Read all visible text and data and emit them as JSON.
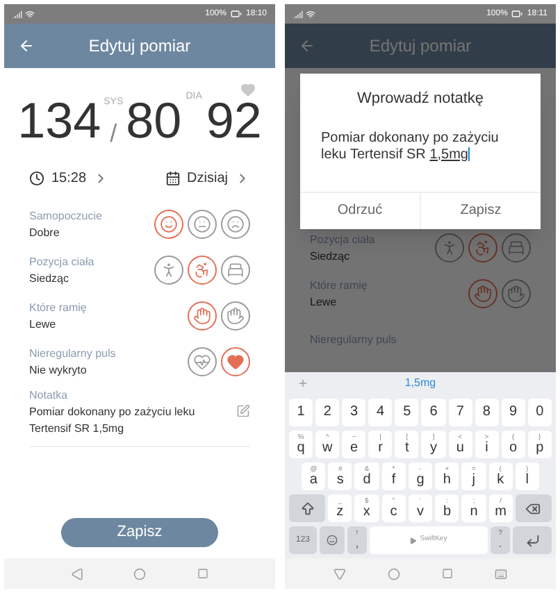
{
  "edit_screen": {
    "status_bar": {
      "battery": "100%",
      "time": "18:10"
    },
    "header": {
      "title": "Edytuj pomiar"
    },
    "reading": {
      "sys_label": "SYS",
      "sys": "134",
      "separator": "/",
      "dia_label": "DIA",
      "dia": "80",
      "pulse": "92"
    },
    "time": "15:28",
    "date": "Dzisiaj",
    "rows": [
      {
        "label": "Samopoczucie",
        "value": "Dobre",
        "options": [
          {
            "kind": "smile",
            "selected": true
          },
          {
            "kind": "neutral",
            "selected": false
          },
          {
            "kind": "sad",
            "selected": false
          }
        ]
      },
      {
        "label": "Pozycja ciała",
        "value": "Siedząc",
        "options": [
          {
            "kind": "standing",
            "selected": false
          },
          {
            "kind": "sitting",
            "selected": true
          },
          {
            "kind": "lying",
            "selected": false
          }
        ]
      },
      {
        "label": "Które ramię",
        "value": "Lewe",
        "options": [
          {
            "kind": "left_hand",
            "selected": true
          },
          {
            "kind": "right_hand",
            "selected": false
          }
        ]
      },
      {
        "label": "Nieregularny puls",
        "value": "Nie wykryto",
        "options": [
          {
            "kind": "pulse",
            "selected": false
          },
          {
            "kind": "heart",
            "selected": true
          }
        ]
      }
    ],
    "note": {
      "label": "Notatka",
      "text": "Pomiar dokonany po zażyciu leku Tertensif SR 1,5mg"
    },
    "save_button": "Zapisz"
  },
  "note_screen": {
    "status_bar": {
      "battery": "100%",
      "time": "18:11"
    },
    "header": {
      "title": "Edytuj pomiar"
    },
    "rows": [
      {
        "label": "Pozycja ciała",
        "value": "Siedząc",
        "options": [
          {
            "kind": "standing",
            "selected": false
          },
          {
            "kind": "sitting",
            "selected": true
          },
          {
            "kind": "lying",
            "selected": false
          }
        ]
      },
      {
        "label": "Które ramię",
        "value": "Lewe",
        "options": [
          {
            "kind": "left_hand",
            "selected": true
          },
          {
            "kind": "right_hand",
            "selected": false
          }
        ]
      },
      {
        "label": "Nieregularny puls"
      }
    ],
    "dialog": {
      "title": "Wprowadź notatkę",
      "text": "Pomiar dokonany po zażyciu leku Tertensif SR ",
      "composing": "1,5mg",
      "buttons": [
        "Odrzuć",
        "Zapisz"
      ]
    },
    "keyboard": {
      "suggestion": "1,5mg",
      "rows": [
        [
          {
            "kind": "char",
            "main": "1"
          },
          {
            "kind": "char",
            "main": "2"
          },
          {
            "kind": "char",
            "main": "3"
          },
          {
            "kind": "char",
            "main": "4"
          },
          {
            "kind": "char",
            "main": "5"
          },
          {
            "kind": "char",
            "main": "6"
          },
          {
            "kind": "char",
            "main": "7"
          },
          {
            "kind": "char",
            "main": "8"
          },
          {
            "kind": "char",
            "main": "9"
          },
          {
            "kind": "char",
            "main": "0"
          }
        ],
        [
          {
            "kind": "char",
            "main": "q",
            "alt": "%"
          },
          {
            "kind": "char",
            "main": "w",
            "alt": "^"
          },
          {
            "kind": "char",
            "main": "e",
            "alt": "~"
          },
          {
            "kind": "char",
            "main": "r",
            "alt": "|"
          },
          {
            "kind": "char",
            "main": "t",
            "alt": "["
          },
          {
            "kind": "char",
            "main": "y",
            "alt": "]"
          },
          {
            "kind": "char",
            "main": "u",
            "alt": "<"
          },
          {
            "kind": "char",
            "main": "i",
            "alt": ">"
          },
          {
            "kind": "char",
            "main": "o",
            "alt": "{"
          },
          {
            "kind": "char",
            "main": "p",
            "alt": "}"
          }
        ],
        [
          {
            "kind": "char",
            "main": "a",
            "alt": "@"
          },
          {
            "kind": "char",
            "main": "s",
            "alt": "#"
          },
          {
            "kind": "char",
            "main": "d",
            "alt": "&"
          },
          {
            "kind": "char",
            "main": "f",
            "alt": "*"
          },
          {
            "kind": "char",
            "main": "g",
            "alt": "-"
          },
          {
            "kind": "char",
            "main": "h",
            "alt": "+"
          },
          {
            "kind": "char",
            "main": "j",
            "alt": "="
          },
          {
            "kind": "char",
            "main": "k",
            "alt": "("
          },
          {
            "kind": "char",
            "main": "l",
            "alt": ")"
          }
        ],
        [
          {
            "kind": "shift"
          },
          {
            "kind": "char",
            "main": "z",
            "alt": "_"
          },
          {
            "kind": "char",
            "main": "x",
            "alt": "$"
          },
          {
            "kind": "char",
            "main": "c",
            "alt": "\""
          },
          {
            "kind": "char",
            "main": "v",
            "alt": "'"
          },
          {
            "kind": "char",
            "main": "b",
            "alt": ":"
          },
          {
            "kind": "char",
            "main": "n",
            "alt": ";"
          },
          {
            "kind": "char",
            "main": "m",
            "alt": "/"
          },
          {
            "kind": "backspace"
          }
        ],
        [
          {
            "kind": "mode",
            "main": "123"
          },
          {
            "kind": "emoji"
          },
          {
            "kind": "punct",
            "main": ",",
            "alt": "!"
          },
          {
            "kind": "space",
            "main": "SwiftKey"
          },
          {
            "kind": "punct",
            "main": ".",
            "alt": "?"
          },
          {
            "kind": "enter"
          }
        ]
      ]
    }
  }
}
